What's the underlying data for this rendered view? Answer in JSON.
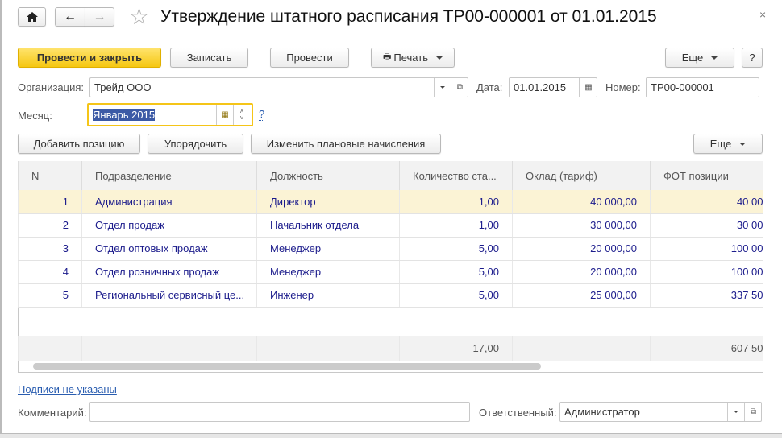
{
  "header": {
    "title": "Утверждение штатного расписания ТР00-000001 от 01.01.2015"
  },
  "toolbar": {
    "post_close": "Провести и закрыть",
    "save": "Записать",
    "post": "Провести",
    "print": "Печать",
    "more": "Еще",
    "help": "?"
  },
  "form": {
    "org_label": "Организация:",
    "org_value": "Трейд ООО",
    "date_label": "Дата:",
    "date_value": "01.01.2015",
    "number_label": "Номер:",
    "number_value": "ТР00-000001",
    "month_label": "Месяц:",
    "month_value": "Январь 2015",
    "month_help": "?"
  },
  "table_toolbar": {
    "add": "Добавить позицию",
    "sort": "Упорядочить",
    "change": "Изменить плановые начисления",
    "more": "Еще"
  },
  "table": {
    "columns": [
      "N",
      "Подразделение",
      "Должность",
      "Количество ста...",
      "Оклад (тариф)",
      "ФОТ  позиции"
    ],
    "rows": [
      [
        "1",
        "Администрация",
        "Директор",
        "1,00",
        "40 000,00",
        "40 00"
      ],
      [
        "2",
        "Отдел продаж",
        "Начальник отдела",
        "1,00",
        "30 000,00",
        "30 00"
      ],
      [
        "3",
        "Отдел оптовых продаж",
        "Менеджер",
        "5,00",
        "20 000,00",
        "100 00"
      ],
      [
        "4",
        "Отдел розничных продаж",
        "Менеджер",
        "5,00",
        "20 000,00",
        "100 00"
      ],
      [
        "5",
        "Региональный сервисный це...",
        "Инженер",
        "5,00",
        "25 000,00",
        "337 50"
      ]
    ],
    "totals": {
      "qty": "17,00",
      "fot": "607 50"
    }
  },
  "footer": {
    "signatures_link": "Подписи не указаны",
    "comment_label": "Комментарий:",
    "comment_value": "",
    "responsible_label": "Ответственный:",
    "responsible_value": "Администратор"
  }
}
